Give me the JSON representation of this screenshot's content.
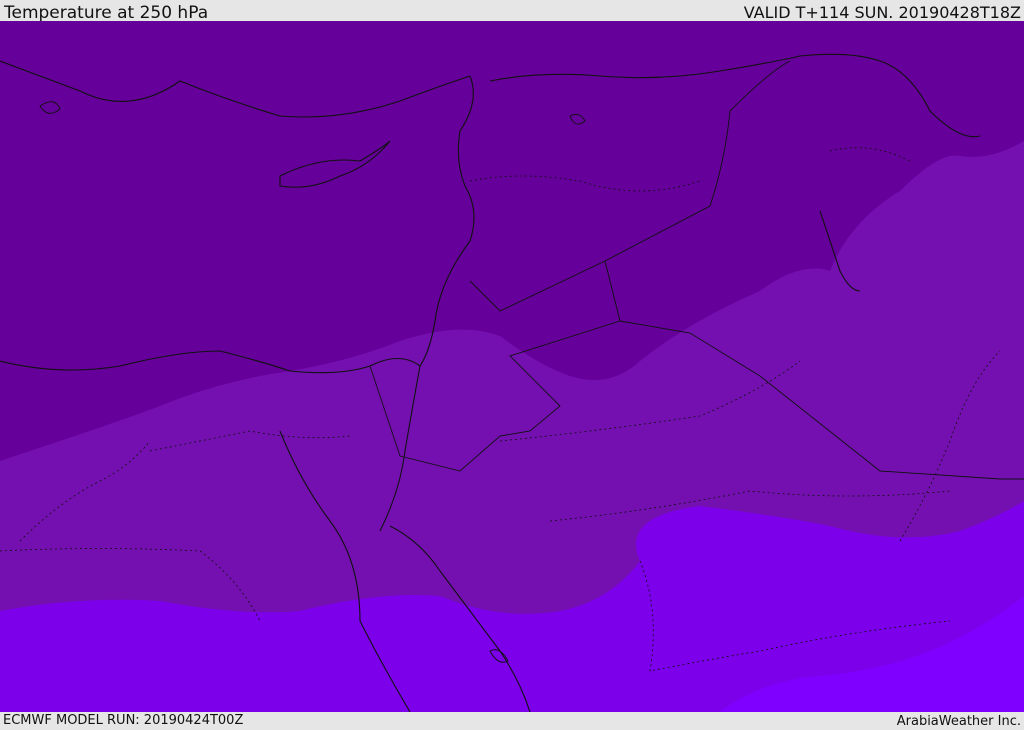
{
  "header": {
    "title": "Temperature at 250 hPa",
    "valid": "VALID T+114 SUN. 20190428T18Z"
  },
  "footer": {
    "model_run": "ECMWF MODEL RUN: 20190424T00Z",
    "credit": "ArabiaWeather Inc."
  },
  "map": {
    "field": "Temperature at 250 hPa",
    "colors": {
      "band_coldest": "#5f0090",
      "band_cold": "#66009a",
      "band_mid": "#7410b0",
      "band_warm": "#7c00ea",
      "band_warmest": "#8000ff",
      "coastline": "#111111"
    }
  }
}
